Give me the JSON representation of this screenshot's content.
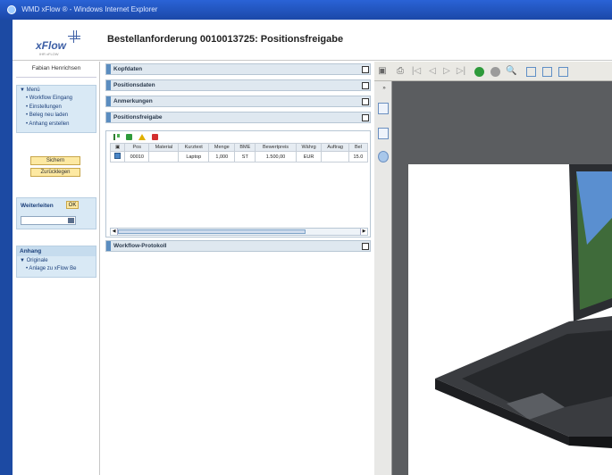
{
  "window": {
    "title": "WMD xFlow ® - Windows Internet Explorer"
  },
  "header": {
    "logo_text": "xFlow",
    "logo_tagline": "IHR xFLOW",
    "page_title": "Bestellanforderung 0010013725: Positionsfreigabe"
  },
  "sidebar": {
    "user_name": "Fabian Henrichsen",
    "menu_title": "▼ Menü",
    "menu_items": [
      {
        "label": "• Workflow Eingang"
      },
      {
        "label": "• Einstellungen"
      },
      {
        "label": "• Beleg neu laden"
      },
      {
        "label": "• Anhang erstellen"
      }
    ],
    "save_label": "Sichern",
    "reset_label": "Zurücklegen",
    "forward_label": "Weiterleiten",
    "ok_label": "OK",
    "attachment_title": "Anhang",
    "attachment_group": "▼ Originale",
    "attachment_item": "• Anlage zu xFlow Be"
  },
  "sections": {
    "kopfdaten": "Kopfdaten",
    "positionsdaten": "Positionsdaten",
    "anmerkungen": "Anmerkungen",
    "positionsfreigabe": "Positionsfreigabe",
    "workflow_protokoll": "Workflow-Protokoll"
  },
  "table": {
    "headers": [
      "Pos",
      "Material",
      "Kurztext",
      "Menge",
      "BME",
      "Bewertpreis",
      "Währg",
      "Auftrag",
      "Bel"
    ],
    "rows": [
      [
        "00010",
        "",
        "Laptop",
        "1,000",
        "ST",
        "1.500,00",
        "EUR",
        "",
        "15.0"
      ]
    ]
  },
  "colors": {
    "ie_frame": "#1c4aa3",
    "section_accent": "#5b8dc0",
    "sidebar_panel": "#d9e9f5",
    "button_yellow": "#fde9a2",
    "viewer_bg": "#5b5d60"
  }
}
